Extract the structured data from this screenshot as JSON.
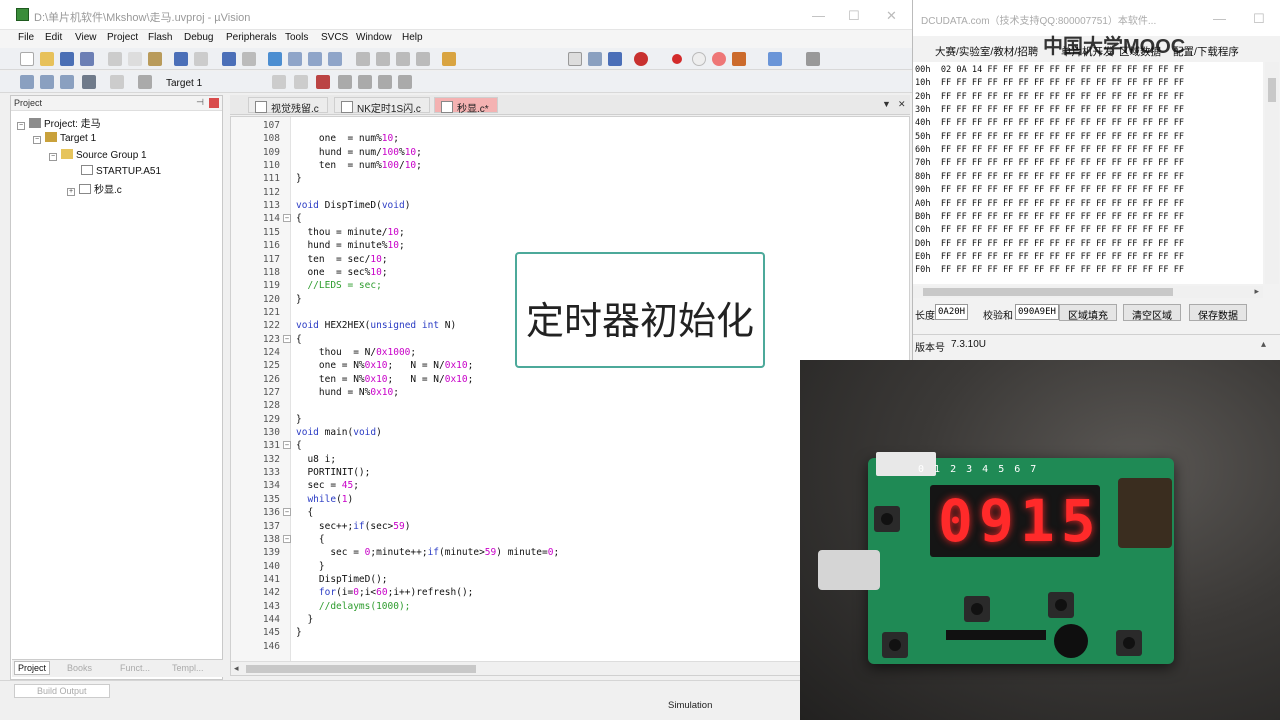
{
  "ide": {
    "title": "D:\\单片机软件\\Mkshow\\走马.uvproj - µVision",
    "menu": [
      "File",
      "Edit",
      "View",
      "Project",
      "Flash",
      "Debug",
      "Peripherals",
      "Tools",
      "SVCS",
      "Window",
      "Help"
    ],
    "target": "Target 1",
    "project_panel": {
      "header": "Project",
      "tree": [
        {
          "label": "Project: 走马"
        },
        {
          "label": "Target 1"
        },
        {
          "label": "Source Group 1"
        },
        {
          "label": "STARTUP.A51"
        },
        {
          "label": "秒显.c"
        }
      ],
      "tabs": [
        "Project",
        "Books",
        "Funct...",
        "Templ..."
      ]
    },
    "editor_tabs": [
      "视觉残留.c",
      "NK定时1S闪.c",
      "秒显.c*"
    ],
    "code": [
      {
        "n": "107",
        "t": ""
      },
      {
        "n": "108",
        "t": "    one  = num%10;"
      },
      {
        "n": "109",
        "t": "    hund = num/100%10;"
      },
      {
        "n": "110",
        "t": "    ten  = num%100/10;"
      },
      {
        "n": "111",
        "t": "}"
      },
      {
        "n": "112",
        "t": ""
      },
      {
        "n": "113",
        "t": "void DispTimeD(void)"
      },
      {
        "n": "114",
        "t": "{"
      },
      {
        "n": "115",
        "t": "  thou = minute/10;"
      },
      {
        "n": "116",
        "t": "  hund = minute%10;"
      },
      {
        "n": "117",
        "t": "  ten  = sec/10;"
      },
      {
        "n": "118",
        "t": "  one  = sec%10;"
      },
      {
        "n": "119",
        "t": "  //LEDS = sec;"
      },
      {
        "n": "120",
        "t": "}"
      },
      {
        "n": "121",
        "t": ""
      },
      {
        "n": "122",
        "t": "void HEX2HEX(unsigned int N)"
      },
      {
        "n": "123",
        "t": "{"
      },
      {
        "n": "124",
        "t": "    thou  = N/0x1000;"
      },
      {
        "n": "125",
        "t": "    one = N%0x10;   N = N/0x10;"
      },
      {
        "n": "126",
        "t": "    ten = N%0x10;   N = N/0x10;"
      },
      {
        "n": "127",
        "t": "    hund = N%0x10;"
      },
      {
        "n": "128",
        "t": ""
      },
      {
        "n": "129",
        "t": "}"
      },
      {
        "n": "130",
        "t": "void main(void)"
      },
      {
        "n": "131",
        "t": "{"
      },
      {
        "n": "132",
        "t": "  u8 i;"
      },
      {
        "n": "133",
        "t": "  PORTINIT();"
      },
      {
        "n": "134",
        "t": "  sec = 45;"
      },
      {
        "n": "135",
        "t": "  while(1)"
      },
      {
        "n": "136",
        "t": "  {"
      },
      {
        "n": "137",
        "t": "    sec++;if(sec>59)"
      },
      {
        "n": "138",
        "t": "    {"
      },
      {
        "n": "139",
        "t": "      sec = 0;minute++;if(minute>59) minute=0;"
      },
      {
        "n": "140",
        "t": "    }"
      },
      {
        "n": "141",
        "t": "    DispTimeD();"
      },
      {
        "n": "142",
        "t": "    for(i=0;i<60;i++)refresh();"
      },
      {
        "n": "143",
        "t": "    //delayms(1000);"
      },
      {
        "n": "144",
        "t": "  }"
      },
      {
        "n": "145",
        "t": "}"
      },
      {
        "n": "146",
        "t": ""
      }
    ],
    "build_output_tab": "Build Output",
    "status": "Simulation"
  },
  "caption": "定时器初始化",
  "tool": {
    "title": "DCUDATA.com（技术支持QQ:800007751）本软件...",
    "logo": "中国大学MOOC",
    "menu": [
      "大赛/实验室/教材/招聘",
      "单片机开发",
      "区域数据",
      "配置/下载程序"
    ],
    "hex_rows": [
      "00h  02 0A 14 FF FF FF FF FF FF FF FF FF FF FF FF FF",
      "10h  FF FF FF FF FF FF FF FF FF FF FF FF FF FF FF FF",
      "20h  FF FF FF FF FF FF FF FF FF FF FF FF FF FF FF FF",
      "30h  FF FF FF FF FF FF FF FF FF FF FF FF FF FF FF FF",
      "40h  FF FF FF FF FF FF FF FF FF FF FF FF FF FF FF FF",
      "50h  FF FF FF FF FF FF FF FF FF FF FF FF FF FF FF FF",
      "60h  FF FF FF FF FF FF FF FF FF FF FF FF FF FF FF FF",
      "70h  FF FF FF FF FF FF FF FF FF FF FF FF FF FF FF FF",
      "80h  FF FF FF FF FF FF FF FF FF FF FF FF FF FF FF FF",
      "90h  FF FF FF FF FF FF FF FF FF FF FF FF FF FF FF FF",
      "A0h  FF FF FF FF FF FF FF FF FF FF FF FF FF FF FF FF",
      "B0h  FF FF FF FF FF FF FF FF FF FF FF FF FF FF FF FF",
      "C0h  FF FF FF FF FF FF FF FF FF FF FF FF FF FF FF FF",
      "D0h  FF FF FF FF FF FF FF FF FF FF FF FF FF FF FF FF",
      "E0h  FF FF FF FF FF FF FF FF FF FF FF FF FF FF FF FF",
      "F0h  FF FF FF FF FF FF FF FF FF FF FF FF FF FF FF FF"
    ],
    "length_label": "长度",
    "length_value": "0A20H",
    "checksum_label": "校验和",
    "checksum_value": "090A9EH",
    "btn_fill": "区域填充",
    "btn_clear": "清空区域",
    "btn_save": "保存数据",
    "version_label": "版本号",
    "version_value": "7.3.10U"
  },
  "camera": {
    "display": "0915",
    "led_labels": "0 1 2 3 4 5 6 7"
  }
}
